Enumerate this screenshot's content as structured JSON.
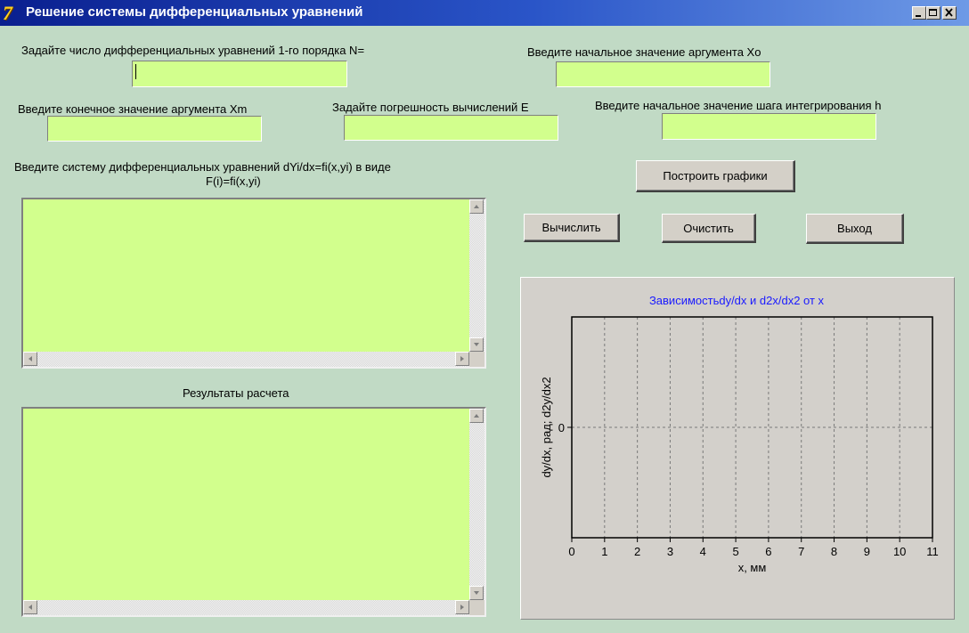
{
  "window": {
    "title": "Решение системы дифференциальных уравнений",
    "icon": "delphi-app-icon",
    "controls": [
      "minimize-icon",
      "maximize-icon",
      "close-icon"
    ]
  },
  "form": {
    "n_label": "Задайте число дифференциальных уравнений 1-го порядка N=",
    "n_value": "",
    "x0_label": "Введите начальное значение аргумента Xo",
    "x0_value": "",
    "xm_label": "Введите конечное значение аргумента Xm",
    "xm_value": "",
    "e_label": "Задайте погрешность вычислений E",
    "e_value": "",
    "h_label": "Введите начальное значение шага интегрирования  h",
    "h_value": "",
    "system_label_line1": "Введите систему дифференциальных уравнений dYi/dx=fi(x,yi) в виде",
    "system_label_line2": "F(i)=fi(x,yi)",
    "system_text": "",
    "results_label": "Результаты расчета",
    "results_text": ""
  },
  "buttons": {
    "plot": "Построить графики",
    "compute": "Вычислить",
    "clear": "Очистить",
    "exit": "Выход"
  },
  "colors": {
    "form_bg": "#c1dac5",
    "field_bg": "#d2ff8d",
    "chart_title": "#1a1aff",
    "chart_panel": "#d3d0cb"
  },
  "chart_data": {
    "type": "line",
    "title": "Зависимостьdy/dx и d2x/dx2 от x",
    "xlabel": "x, мм",
    "ylabel": "dy/dx, рад; d2y/dx2",
    "xlim": [
      0,
      11
    ],
    "x_ticks": [
      "0",
      "1",
      "2",
      "3",
      "4",
      "5",
      "6",
      "7",
      "8",
      "9",
      "10",
      "11"
    ],
    "y_ticks": [
      "0"
    ],
    "grid": true,
    "series": []
  }
}
